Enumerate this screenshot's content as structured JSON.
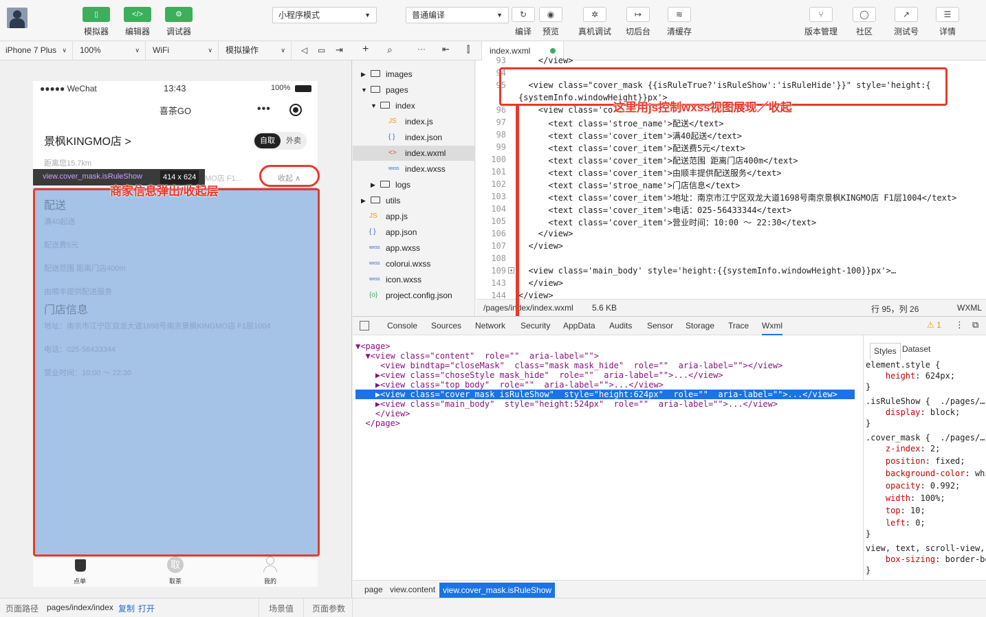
{
  "toolbar": {
    "simulator": "模拟器",
    "editor": "编辑器",
    "debugger": "调试器",
    "mode_select": "小程序模式",
    "compile_select": "普通编译",
    "compile": "编译",
    "preview": "预览",
    "device_debug": "真机调试",
    "switch_bg": "切后台",
    "clear_cache": "清缓存",
    "version": "版本管理",
    "community": "社区",
    "test_account": "测试号",
    "details": "详情"
  },
  "bar2": {
    "device": "iPhone 7 Plus",
    "zoom": "100%",
    "network": "WiFi",
    "sim_ops": "模拟操作"
  },
  "phone": {
    "carrier": "●●●●● WeChat",
    "time": "13:43",
    "battery": "100%",
    "nav_title": "喜茶GO",
    "store_name": "景枫KINGMO店 >",
    "pickup": "自取",
    "delivery": "外卖",
    "distance": "距离您15.7km",
    "inspect_label": "view.cover_mask.isRuleShow",
    "inspect_size": "414 x 624",
    "addr_partial": "MO店 F1...",
    "collapse": "收起 ∧",
    "mask": {
      "section1": "配送",
      "items1": [
        "满40起送",
        "配送费5元",
        "配送范围 距离门店400m",
        "由顺丰提供配送服务"
      ],
      "section2": "门店信息",
      "items2": [
        "地址：南京市江宁区双龙大道1698号南京景枫KINGMO店 F1层1004",
        "电话：025-56433344",
        "营业时间：10:00 ～ 22:30"
      ]
    },
    "tabs": [
      "点单",
      "取茶",
      "我的"
    ],
    "tab_badge": "取"
  },
  "annotations": {
    "left": "商家信息弹出/收起层",
    "right": "这里用js控制wxss视图展现／收起"
  },
  "tree": {
    "items": [
      {
        "label": "images",
        "type": "folder",
        "open": false
      },
      {
        "label": "pages",
        "type": "folder",
        "open": true
      },
      {
        "label": "index",
        "type": "folder",
        "open": true
      },
      {
        "label": "index.js",
        "type": "js"
      },
      {
        "label": "index.json",
        "type": "json"
      },
      {
        "label": "index.wxml",
        "type": "wxml"
      },
      {
        "label": "index.wxss",
        "type": "wxss"
      },
      {
        "label": "logs",
        "type": "folder",
        "open": false
      },
      {
        "label": "utils",
        "type": "folder",
        "open": false
      },
      {
        "label": "app.js",
        "type": "js"
      },
      {
        "label": "app.json",
        "type": "json"
      },
      {
        "label": "app.wxss",
        "type": "wxss"
      },
      {
        "label": "colorui.wxss",
        "type": "wxss"
      },
      {
        "label": "icon.wxss",
        "type": "wxss"
      },
      {
        "label": "project.config.json",
        "type": "config"
      }
    ]
  },
  "editor": {
    "tab": "index.wxml",
    "lines": [
      {
        "n": "93",
        "t": "    </view>"
      },
      {
        "n": "94",
        "t": ""
      },
      {
        "n": "95",
        "t": "  <view class=\"cover_mask {{isRuleTrue?'isRuleShow':'isRuleHide'}}\" style='height:{"
      },
      {
        "n": "",
        "t": "{systemInfo.windowHeight}}px'>"
      },
      {
        "n": "96",
        "t": "    <view class='co"
      },
      {
        "n": "97",
        "t": "      <text class='stroe_name'>配送</text>"
      },
      {
        "n": "98",
        "t": "      <text class='cover_item'>满40起送</text>"
      },
      {
        "n": "99",
        "t": "      <text class='cover_item'>配送费5元</text>"
      },
      {
        "n": "100",
        "t": "      <text class='cover_item'>配送范围 距离门店400m</text>"
      },
      {
        "n": "101",
        "t": "      <text class='cover_item'>由顺丰提供配送服务</text>"
      },
      {
        "n": "102",
        "t": "      <text class='stroe_name'>门店信息</text>"
      },
      {
        "n": "103",
        "t": "      <text class='cover_item'>地址：南京市江宁区双龙大道1698号南京景枫KINGMO店 F1层1004</text>"
      },
      {
        "n": "104",
        "t": "      <text class='cover_item'>电话：025-56433344</text>"
      },
      {
        "n": "105",
        "t": "      <text class='cover_item'>营业时间：10:00 ～ 22:30</text>"
      },
      {
        "n": "106",
        "t": "    </view>"
      },
      {
        "n": "107",
        "t": "  </view>"
      },
      {
        "n": "108",
        "t": ""
      },
      {
        "n": "109",
        "t": "  <view class='main_body' style='height:{{systemInfo.windowHeight-100}}px'>…"
      },
      {
        "n": "143",
        "t": "  </view>"
      },
      {
        "n": "144",
        "t": "</view>"
      }
    ],
    "path": "/pages/index/index.wxml",
    "size": "5.6 KB",
    "position": "行 95，列 26",
    "lang": "WXML"
  },
  "devtools": {
    "tabs": [
      "Console",
      "Sources",
      "Network",
      "Security",
      "AppData",
      "Audits",
      "Sensor",
      "Storage",
      "Trace",
      "Wxml"
    ],
    "warn": "⚠ 1",
    "wxml": [
      "▼<page>",
      "  ▼<view class=\"content\"  role=\"\"  aria-label=\"\">",
      "     <view bindtap=\"closeMask\"  class=\"mask mask_hide\"  role=\"\"  aria-label=\"\"></view>",
      "    ▶<view class=\"choseStyle mask_hide\"  role=\"\"  aria-label=\"\">...</view>",
      "    ▶<view class=\"top_body\"  role=\"\"  aria-label=\"\">...</view>",
      "    ▶<view class=\"cover_mask isRuleShow\"  style=\"height:624px\"  role=\"\"  aria-label=\"\">...</view>",
      "    ▶<view class=\"main_body\"  style=\"height:524px\"  role=\"\"  aria-label=\"\">...</view>",
      "    </view>",
      "  </page>"
    ],
    "styles_tab": "Styles",
    "dataset_tab": "Dataset",
    "styles": [
      "element.style {",
      "    height: 624px;",
      "}",
      ".isRuleShow {  ./pages/…",
      "    display: block;",
      "}",
      ".cover_mask {  ./pages/…",
      "    z-index: 2;",
      "    position: fixed;",
      "    background-color: whi",
      "    opacity: 0.992;",
      "    width: 100%;",
      "    top: 10;",
      "    left: 0;",
      "}",
      "view, text, scroll-view,",
      "    box-sizing: border-bo",
      "}"
    ],
    "crumbs": [
      "page",
      "view.content",
      "view.cover_mask.isRuleShow"
    ]
  },
  "status": {
    "path_label": "页面路径",
    "path": "pages/index/index",
    "copy": "复制",
    "open": "打开",
    "scene": "场景值",
    "params": "页面参数"
  }
}
